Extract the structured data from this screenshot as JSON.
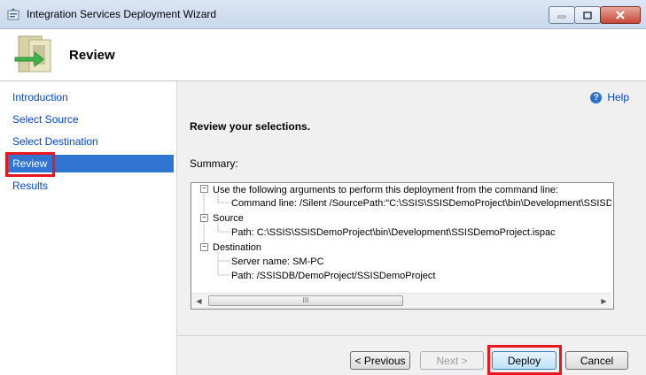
{
  "window": {
    "title": "Integration Services Deployment Wizard"
  },
  "header": {
    "title": "Review"
  },
  "sidebar": {
    "items": [
      {
        "label": "Introduction"
      },
      {
        "label": "Select Source"
      },
      {
        "label": "Select Destination"
      },
      {
        "label": "Review"
      },
      {
        "label": "Results"
      }
    ],
    "selected": "Review"
  },
  "help": {
    "label": "Help"
  },
  "main": {
    "heading": "Review your selections.",
    "summary_label": "Summary:",
    "tree": [
      {
        "text": "Use the following arguments to perform this deployment from the command line:"
      },
      {
        "text": "Command line: /Silent /SourcePath:\"C:\\SSIS\\SSISDemoProject\\bin\\Development\\SSISDe"
      },
      {
        "text": "Source"
      },
      {
        "text": "Path: C:\\SSIS\\SSISDemoProject\\bin\\Development\\SSISDemoProject.ispac"
      },
      {
        "text": "Destination"
      },
      {
        "text": "Server name: SM-PC"
      },
      {
        "text": "Path: /SSISDB/DemoProject/SSISDemoProject"
      }
    ],
    "scroll_thumb_grip": "III"
  },
  "buttons": {
    "previous": "< Previous",
    "next": "Next >",
    "deploy": "Deploy",
    "cancel": "Cancel"
  },
  "colors": {
    "highlight": "#e8161e",
    "selection": "#3075d1",
    "link": "#0046c6"
  }
}
